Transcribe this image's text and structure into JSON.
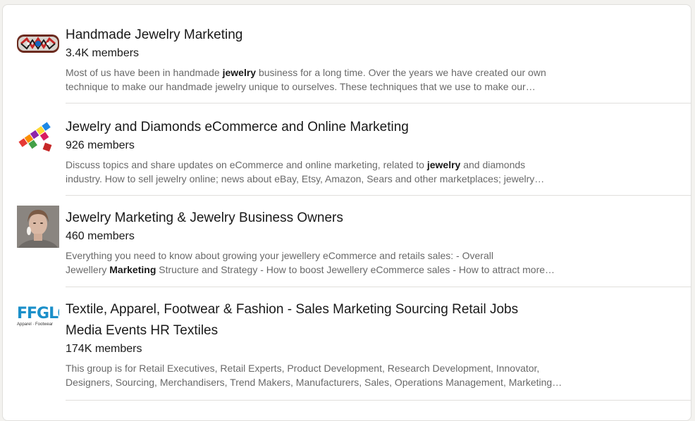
{
  "groups": [
    {
      "title": "Handmade Jewelry Marketing",
      "members": "3.4K members",
      "desc_pre1": "Most of us have been in handmade ",
      "desc_bold": "jewelry",
      "desc_post1": " business for a long time. Over the years we have created our own",
      "desc_line2": "technique to make our handmade jewelry unique to ourselves. These techniques that we use to make our…",
      "thumb_icon": "beaded-bracelet-image"
    },
    {
      "title": "Jewelry and Diamonds eCommerce and Online Marketing",
      "members": "926 members",
      "desc_pre1": "Discuss topics and share updates on eCommerce and online marketing, related to ",
      "desc_bold": "jewelry",
      "desc_post1": " and diamonds",
      "desc_line2": "industry. How to sell jewelry online; news about eBay, Etsy, Amazon, Sears and other marketplaces; jewelry…",
      "thumb_icon": "colorful-tiles-image"
    },
    {
      "title": "Jewelry Marketing & Jewelry Business Owners",
      "members": "460 members",
      "desc_line1": "Everything you need to know about growing your jewellery eCommerce and retails sales: - Overall",
      "desc_pre2": "Jewellery ",
      "desc_bold": "Marketing",
      "desc_post2": " Structure and Strategy - How to boost Jewellery eCommerce sales - How to attract more…",
      "thumb_icon": "woman-portrait-image"
    },
    {
      "title_line1": "Textile, Apparel, Footwear & Fashion - Sales Marketing Sourcing Retail Jobs",
      "title_line2": "Media Events HR Textiles",
      "members": "174K members",
      "desc_line1": "This group is for Retail Executives, Retail Experts, Product Development, Research Development, Innovator,",
      "desc_line2": "Designers, Sourcing, Merchandisers, Trend Makers, Manufacturers, Sales, Operations Management, Marketing…",
      "logo_text": "FFGLOB",
      "logo_sub": "Apparel · Footwear",
      "thumb_icon": "fglobal-logo"
    }
  ],
  "colors": {
    "background": "#f3f2ef",
    "card": "#ffffff",
    "divider": "#e0dfdc",
    "logo_blue": "#1a8fc9"
  }
}
